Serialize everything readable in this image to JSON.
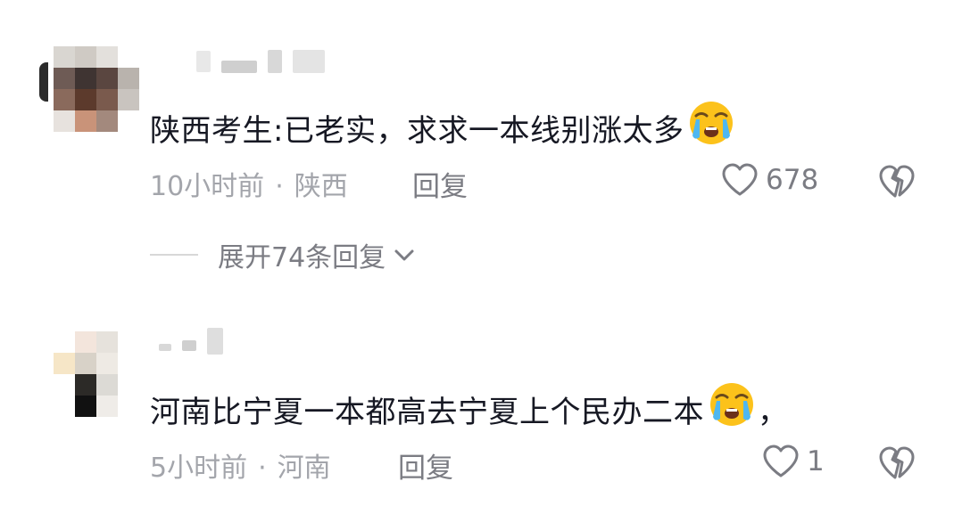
{
  "comments": [
    {
      "text": "陕西考生:已老实，求求一本线别涨太多",
      "emoji": "loudly-crying-face",
      "time": "10小时前",
      "region": "陕西",
      "reply_label": "回复",
      "likes": "678",
      "like_icon": "heart-outline-icon",
      "dislike_icon": "broken-heart-icon",
      "expand_label": "展开74条回复"
    },
    {
      "text": "河南比宁夏一本都高去宁夏上个民办二本",
      "emoji": "loudly-crying-face",
      "trailing": "，",
      "time": "5小时前",
      "region": "河南",
      "reply_label": "回复",
      "likes": "1",
      "like_icon": "heart-outline-icon",
      "dislike_icon": "broken-heart-icon"
    }
  ],
  "meta_separator": "·",
  "colors": {
    "text": "#161823",
    "meta": "#a3a5ab",
    "action": "#7b7c83",
    "emoji_face": "#fcc21b"
  }
}
